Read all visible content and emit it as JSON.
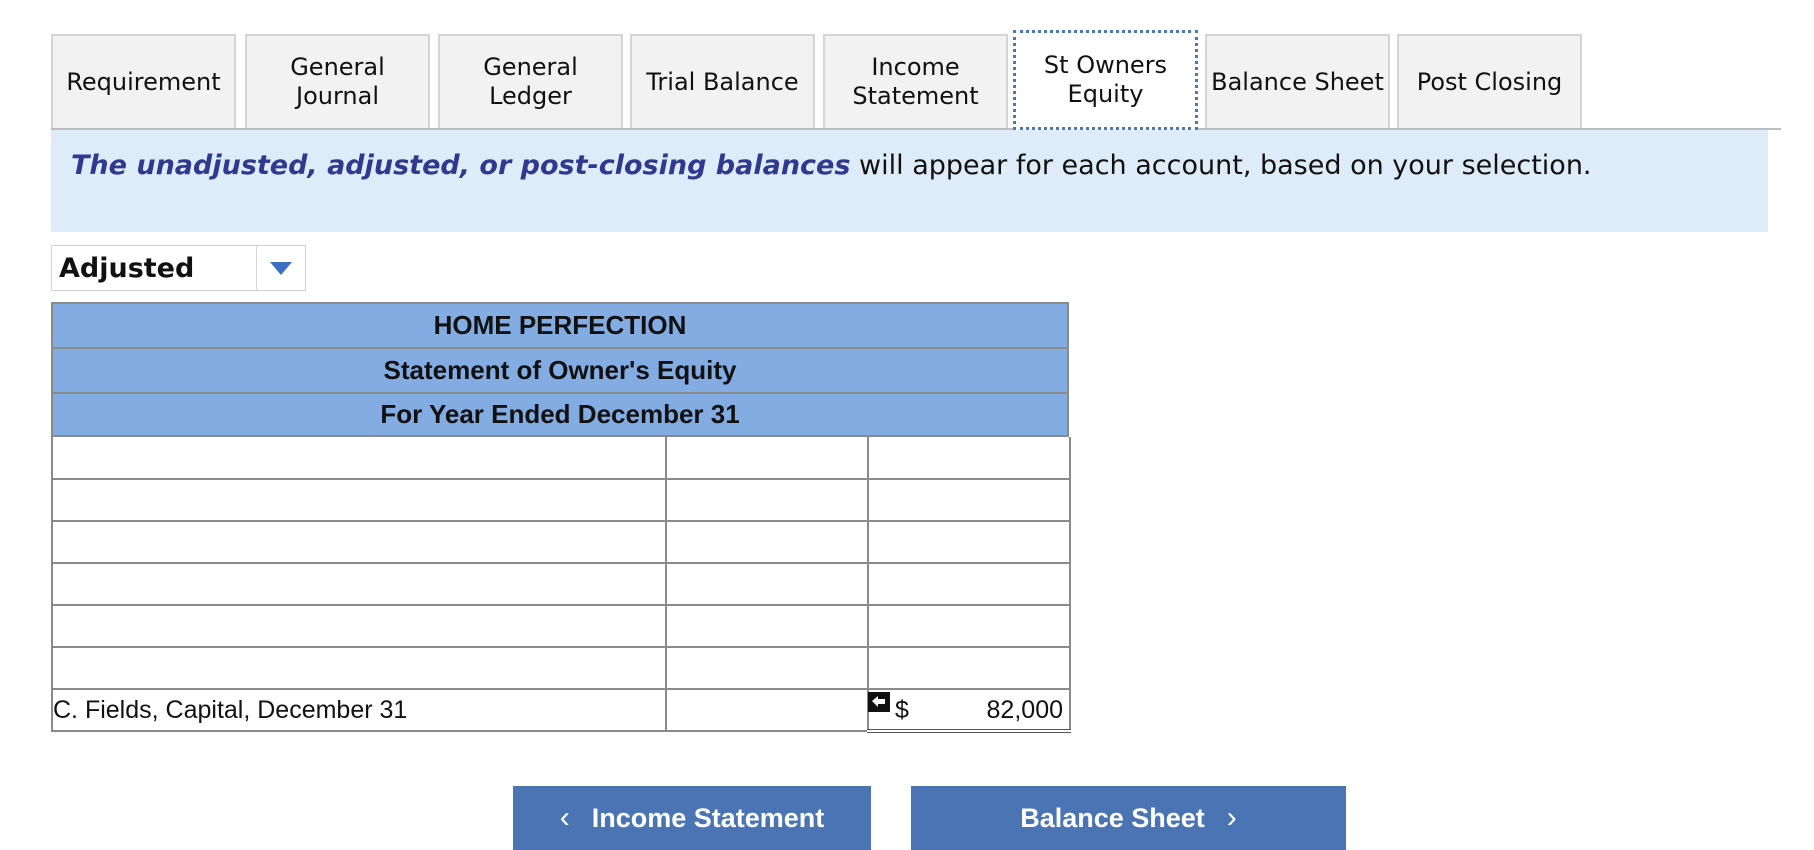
{
  "tabs": [
    {
      "label": "Requirement"
    },
    {
      "label": "General\nJournal"
    },
    {
      "label": "General\nLedger"
    },
    {
      "label": "Trial Balance"
    },
    {
      "label": "Income\nStatement"
    },
    {
      "label": "St Owners\nEquity"
    },
    {
      "label": "Balance Sheet"
    },
    {
      "label": "Post Closing"
    }
  ],
  "active_tab": "St Owners Equity",
  "info": {
    "emphasis": "The unadjusted, adjusted, or post-closing balances",
    "rest": " will appear for each account, based on your selection."
  },
  "balance_select": {
    "value": "Adjusted"
  },
  "statement": {
    "company": "HOME PERFECTION",
    "title": "Statement of Owner's Equity",
    "period": "For Year Ended December 31",
    "final_row": {
      "label": "C. Fields, Capital, December 31",
      "currency": "$",
      "amount": "82,000"
    }
  },
  "nav": {
    "prev_label": "Income Statement",
    "next_label": "Balance Sheet"
  },
  "colors": {
    "header_blue": "#83ace2",
    "banner_blue": "#deebf8",
    "button_blue": "#4a74b4",
    "emphasis_text": "#2f3a8f"
  }
}
